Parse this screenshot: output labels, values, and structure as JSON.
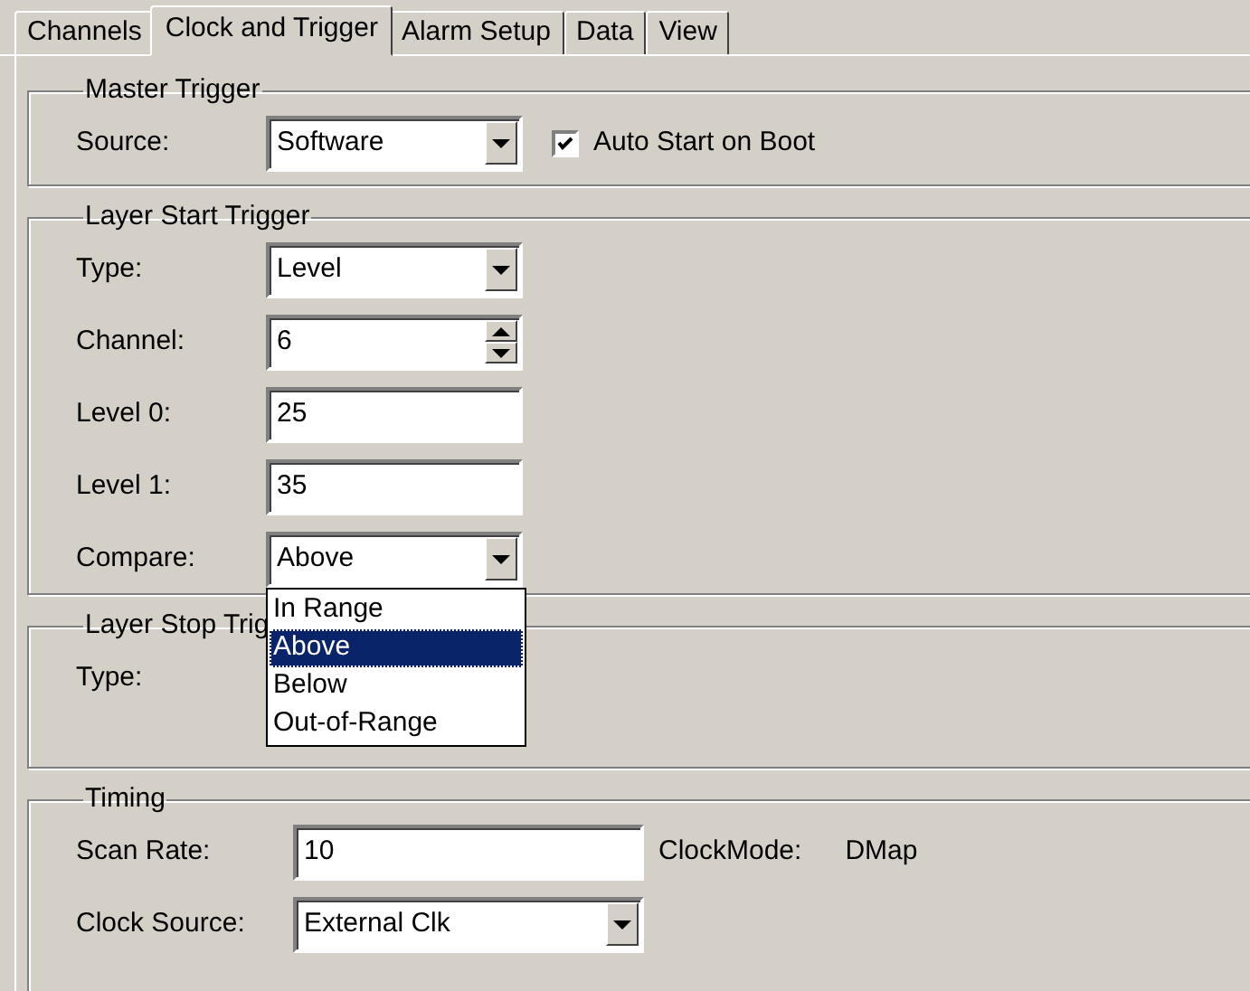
{
  "tabs": [
    {
      "label": "Channels",
      "selected": false
    },
    {
      "label": "Clock and Trigger",
      "selected": true
    },
    {
      "label": "Alarm Setup",
      "selected": false
    },
    {
      "label": "Data",
      "selected": false
    },
    {
      "label": "View",
      "selected": false
    }
  ],
  "master_trigger": {
    "title": "Master Trigger",
    "fields": [
      {
        "kind": "combo",
        "label": "Source:",
        "value": "Software"
      }
    ],
    "auto_start": {
      "label": "Auto Start on Boot",
      "checked": true
    }
  },
  "layer_start_trigger": {
    "title": "Layer Start Trigger",
    "fields": [
      {
        "kind": "combo",
        "label": "Type:",
        "value": "Level"
      },
      {
        "kind": "spin",
        "label": "Channel:",
        "value": "6"
      },
      {
        "kind": "text",
        "label": "Level 0:",
        "value": "25"
      },
      {
        "kind": "text",
        "label": "Level 1:",
        "value": "35"
      },
      {
        "kind": "combo",
        "label": "Compare:",
        "value": "Above"
      }
    ]
  },
  "compare_dropdown": {
    "options": [
      {
        "label": "In Range",
        "selected": false
      },
      {
        "label": "Above",
        "selected": true
      },
      {
        "label": "Below",
        "selected": false
      },
      {
        "label": "Out-of-Range",
        "selected": false
      }
    ]
  },
  "layer_stop_trigger": {
    "title": "Layer Stop Trig",
    "fields": [
      {
        "label": "Type:"
      }
    ]
  },
  "timing": {
    "title": "Timing",
    "scan_rate": {
      "label": "Scan Rate:",
      "value": "10"
    },
    "clock_mode": {
      "label": "ClockMode:",
      "value": "DMap"
    },
    "clock_source": {
      "label": "Clock Source:",
      "value": "External Clk"
    }
  }
}
